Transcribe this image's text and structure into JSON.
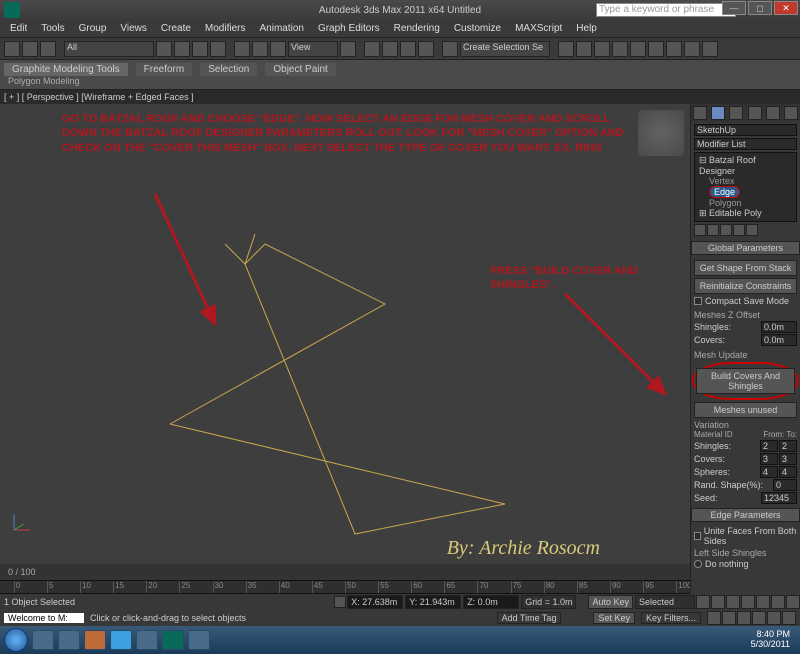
{
  "titlebar": {
    "title": "Autodesk 3ds Max 2011 x64    Untitled",
    "search_placeholder": "Type a keyword or phrase"
  },
  "menu": [
    "Edit",
    "Tools",
    "Group",
    "Views",
    "Create",
    "Modifiers",
    "Animation",
    "Graph Editors",
    "Rendering",
    "Customize",
    "MAXScript",
    "Help"
  ],
  "toolbar": {
    "selection_set": "Create Selection Se"
  },
  "ribbon": {
    "tabs": [
      "Graphite Modeling Tools",
      "Freeform",
      "Selection",
      "Object Paint"
    ],
    "sub": "Polygon Modeling"
  },
  "viewport": {
    "label": "[ + ] [ Perspective ] [Wireframe + Edged Faces ]"
  },
  "annotation1": "GO TO BATZAL ROOF AND CHOOSE \"EDGE\". NOW SELECT AN EDGE FOR MESH COVER AND SCROLL DOWN THE BATZAL ROOF DESIGNER PARAMETERS ROLL OUT. LOOK FOR \"MESH COVER\" OPTION AND CHECK ON THE \"COVER THIS MESH\" BOX. NEXT SELECT THE TYPE OF COVER YOU WANT. EX. RING",
  "annotation2": "PRESS \"BUILD COVER AND SHINGLES\".",
  "byline": "By: Archie Rosocm",
  "sidepanel": {
    "rollout": "SketchUp",
    "modifier_list_label": "Modifier List",
    "stack": {
      "mod": "Batzal Roof Designer",
      "subs": [
        "Vertex",
        "Edge",
        "Polygon"
      ],
      "selected": "Edge",
      "base": "Editable Poly"
    },
    "global": {
      "title": "Global Parameters",
      "get_shape": "Get Shape From Stack",
      "reinit": "Reinitialize Constraints",
      "compact": "Compact Save Mode",
      "meshes_z": "Meshes Z Offset",
      "shingles_label": "Shingles:",
      "shingles_val": "0.0m",
      "covers_label": "Covers:",
      "covers_val": "0.0m",
      "mesh_update": "Mesh Update",
      "build": "Build Covers And Shingles",
      "unused": "Meshes unused",
      "variation": "Variation",
      "matid": "Material ID",
      "from": "From:",
      "to": "To:",
      "row_shingles": "Shingles:",
      "sh_from": "2",
      "sh_to": "2",
      "row_covers": "Covers:",
      "cv_from": "3",
      "cv_to": "3",
      "row_spheres": "Spheres:",
      "sp_from": "4",
      "sp_to": "4",
      "rand": "Rand. Shape(%):",
      "rand_val": "0",
      "seed": "Seed:",
      "seed_val": "12345"
    },
    "edge_params": {
      "title": "Edge Parameters",
      "unite": "Unite Faces From Both Sides",
      "left_side": "Left Side Shingles",
      "do_nothing": "Do nothing"
    }
  },
  "time": {
    "frame": "0 / 100",
    "marks": [
      "0",
      "5",
      "10",
      "15",
      "20",
      "25",
      "30",
      "35",
      "40",
      "45",
      "50",
      "55",
      "60",
      "65",
      "70",
      "75",
      "80",
      "85",
      "90",
      "95",
      "100"
    ]
  },
  "status": {
    "objects": "1 Object Selected",
    "x": "X: 27.638m",
    "y": "Y: 21.943m",
    "z": "Z: 0.0m",
    "grid": "Grid = 1.0m",
    "autokey": "Auto Key",
    "selected": "Selected"
  },
  "prompt": {
    "welcome": "Welcome to M:",
    "hint": "Click or click-and-drag to select objects",
    "addtag": "Add Time Tag",
    "setkey": "Set Key",
    "keyfilters": "Key Filters..."
  },
  "taskbar": {
    "time": "8:40 PM",
    "date": "5/30/2011"
  }
}
